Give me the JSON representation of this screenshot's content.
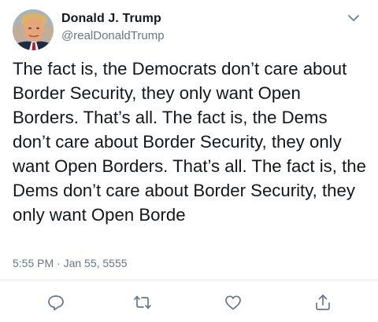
{
  "user": {
    "name": "Donald J. Trump",
    "handle": "@realDonaldTrump"
  },
  "tweet": {
    "text": "The fact is, the Democrats don’t care about Border Security, they only want Open Borders. That’s all. The fact is, the Dems don’t care about Border Security, they only want Open Borders. That’s all. The fact is, the Dems don’t care about Border Security, they only want Open Borde",
    "timestamp": "5:55 PM · Jan 55, 5555"
  },
  "icons": {
    "menu": "chevron-down-icon",
    "reply": "reply-icon",
    "retweet": "retweet-icon",
    "like": "heart-icon",
    "share": "share-icon"
  },
  "colors": {
    "text": "#14171a",
    "secondary": "#657786",
    "icon": "#657786",
    "divider": "#e6ecf0"
  }
}
